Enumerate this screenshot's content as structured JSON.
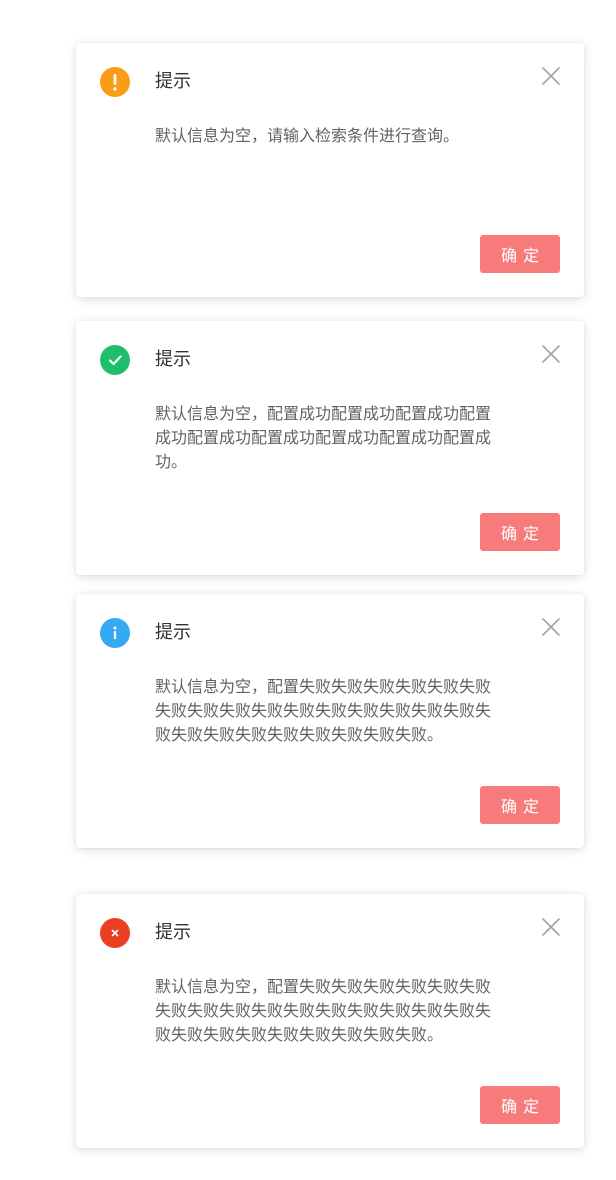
{
  "dialogs": [
    {
      "type": "warning",
      "icon": "exclamation-icon",
      "icon_color": "#fa9d14",
      "title": "提示",
      "message": "默认信息为空，请输入检索条件进行查询。",
      "confirm_label": "确定"
    },
    {
      "type": "success",
      "icon": "check-icon",
      "icon_color": "#1fbe6a",
      "title": "提示",
      "message": "默认信息为空，配置成功配置成功配置成功配置成功配置成功配置成功配置成功配置成功配置成功。",
      "confirm_label": "确定"
    },
    {
      "type": "info",
      "icon": "info-icon",
      "icon_color": "#35a9f1",
      "title": "提示",
      "message": "默认信息为空，配置失败失败失败失败失败失败失败失败失败失败失败失败失败失败失败失败失败失败失败失败失败失败失败失败失败。",
      "confirm_label": "确定"
    },
    {
      "type": "error",
      "icon": "cross-icon",
      "icon_color": "#eb3f23",
      "title": "提示",
      "message": "默认信息为空，配置失败失败失败失败失败失败失败失败失败失败失败失败失败失败失败失败失败失败失败失败失败失败失败失败失败。",
      "confirm_label": "确定"
    }
  ],
  "colors": {
    "confirm_button": "#f77b7b",
    "title_text": "#303133",
    "message_text": "#606266",
    "close_icon": "#a0a3a8"
  }
}
